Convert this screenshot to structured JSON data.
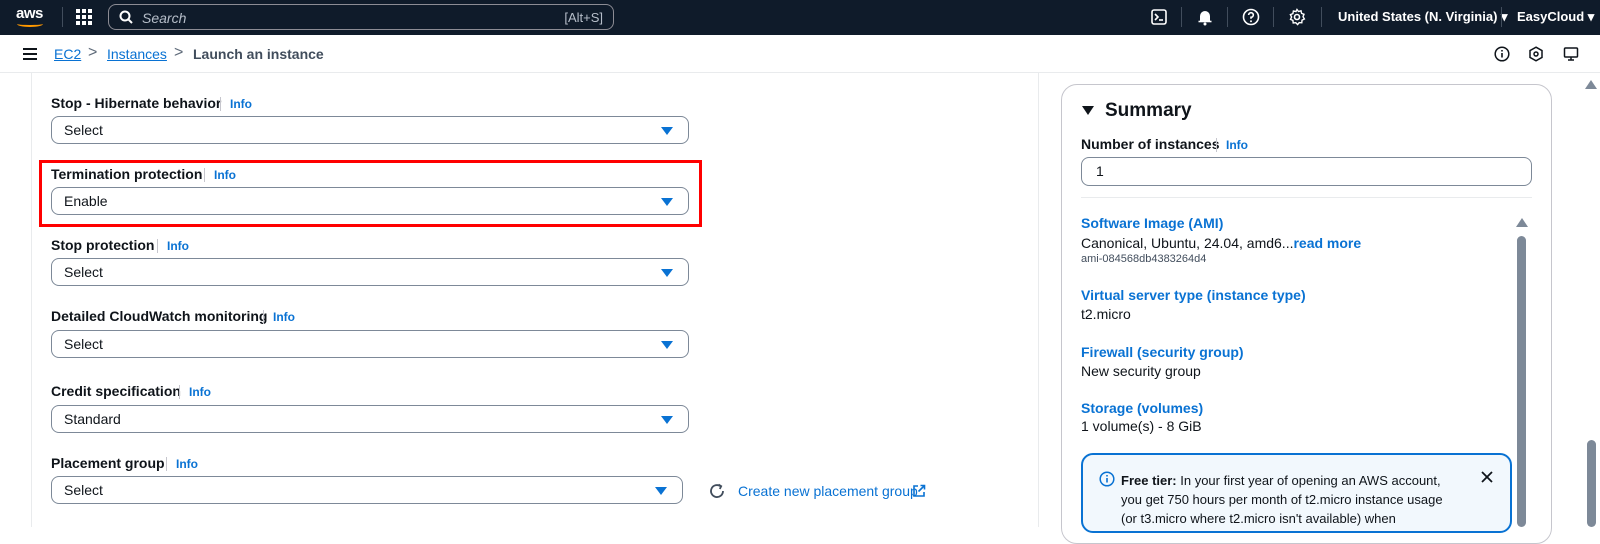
{
  "topnav": {
    "logo": "aws",
    "search_placeholder": "Search",
    "search_shortcut": "[Alt+S]",
    "region": "United States (N. Virginia) ▾",
    "account": "EasyCloud ▾"
  },
  "breadcrumb": {
    "items": [
      "EC2",
      "Instances",
      "Launch an instance"
    ],
    "separator": ">"
  },
  "form": {
    "fields": [
      {
        "label": "Stop - Hibernate behavior",
        "info": "Info",
        "value": "Select"
      },
      {
        "label": "Termination protection",
        "info": "Info",
        "value": "Enable"
      },
      {
        "label": "Stop protection",
        "info": "Info",
        "value": "Select"
      },
      {
        "label": "Detailed CloudWatch monitoring",
        "info": "Info",
        "value": "Select"
      },
      {
        "label": "Credit specification",
        "info": "Info",
        "value": "Standard"
      },
      {
        "label": "Placement group",
        "info": "Info",
        "value": "Select"
      }
    ],
    "create_placement_group": "Create new placement group"
  },
  "summary": {
    "title": "Summary",
    "num_instances_label": "Number of instances",
    "num_instances_info": "Info",
    "num_instances_value": "1",
    "ami_label": "Software Image (AMI)",
    "ami_text": "Canonical, Ubuntu, 24.04, amd6...",
    "ami_read_more": "read more",
    "ami_id": "ami-084568db4383264d4",
    "instance_type_label": "Virtual server type (instance type)",
    "instance_type_value": "t2.micro",
    "firewall_label": "Firewall (security group)",
    "firewall_value": "New security group",
    "storage_label": "Storage (volumes)",
    "storage_value": "1 volume(s) - 8 GiB",
    "free_tier_bold": "Free tier:",
    "free_tier_text": " In your first year of opening an AWS account, you get 750 hours per month of t2.micro instance usage (or t3.micro where t2.micro isn't available) when"
  },
  "colors": {
    "nav_bg": "#0f1b2a",
    "link": "#0972d3",
    "highlight": "#ff0000"
  }
}
